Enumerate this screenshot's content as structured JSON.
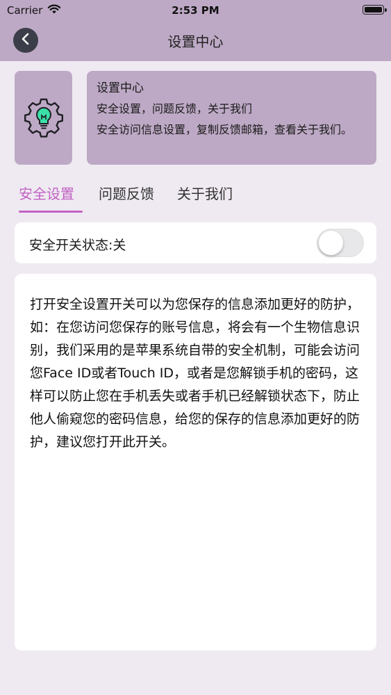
{
  "status_bar": {
    "carrier": "Carrier",
    "time": "2:53 PM"
  },
  "nav": {
    "title": "设置中心",
    "back_icon": "chevron-left-icon"
  },
  "header_card": {
    "icon": "gear-bulb-icon",
    "title": "设置中心",
    "subtitle": "安全设置，问题反馈，关于我们",
    "description": "安全访问信息设置，复制反馈邮箱，查看关于我们。"
  },
  "tabs": [
    {
      "label": "安全设置",
      "active": true
    },
    {
      "label": "问题反馈",
      "active": false
    },
    {
      "label": "关于我们",
      "active": false
    }
  ],
  "security_switch": {
    "label": "安全开关状态:关",
    "on": false
  },
  "security_text": "打开安全设置开关可以为您保存的信息添加更好的防护，如：在您访问您保存的账号信息，将会有一个生物信息识别，我们采用的是苹果系统自带的安全机制，可能会访问您Face ID或者Touch ID，或者是您解锁手机的密码，这样可以防止您在手机丢失或者手机已经解锁状态下，防止他人偷窥您的密码信息，给您的保存的信息添加更好的防护，建议您打开此开关。",
  "colors": {
    "header_bg": "#bda9c5",
    "page_bg": "#efeaf1",
    "accent": "#c262c4",
    "bulb": "#3be0a8"
  }
}
